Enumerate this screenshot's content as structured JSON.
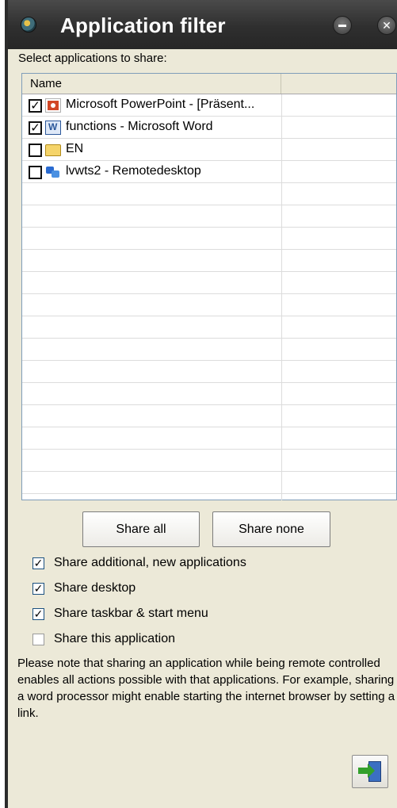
{
  "window": {
    "title": "Application filter"
  },
  "prompt": "Select applications to share:",
  "list": {
    "columns": [
      "Name",
      ""
    ],
    "items": [
      {
        "label": "Microsoft PowerPoint - [Präsent...",
        "checked": true,
        "icon": "powerpoint-icon"
      },
      {
        "label": "functions - Microsoft Word",
        "checked": true,
        "icon": "word-icon"
      },
      {
        "label": "EN",
        "checked": false,
        "icon": "folder-icon"
      },
      {
        "label": "lvwts2 - Remotedesktop",
        "checked": false,
        "icon": "remote-desktop-icon"
      }
    ]
  },
  "buttons": {
    "share_all": "Share all",
    "share_none": "Share none"
  },
  "options": [
    {
      "label": "Share additional, new applications",
      "checked": true
    },
    {
      "label": "Share desktop",
      "checked": true
    },
    {
      "label": "Share taskbar & start menu",
      "checked": true
    },
    {
      "label": "Share this application",
      "checked": false
    }
  ],
  "note": "Please note that sharing an application while being remote controlled enables all actions possible with that applications. For example, sharing a word processor might enable starting the internet browser by setting a link.",
  "icons": {
    "app_logo": "app-logo-icon",
    "minimize": "minimize-icon",
    "close": "close-icon",
    "exit": "exit-door-icon"
  }
}
